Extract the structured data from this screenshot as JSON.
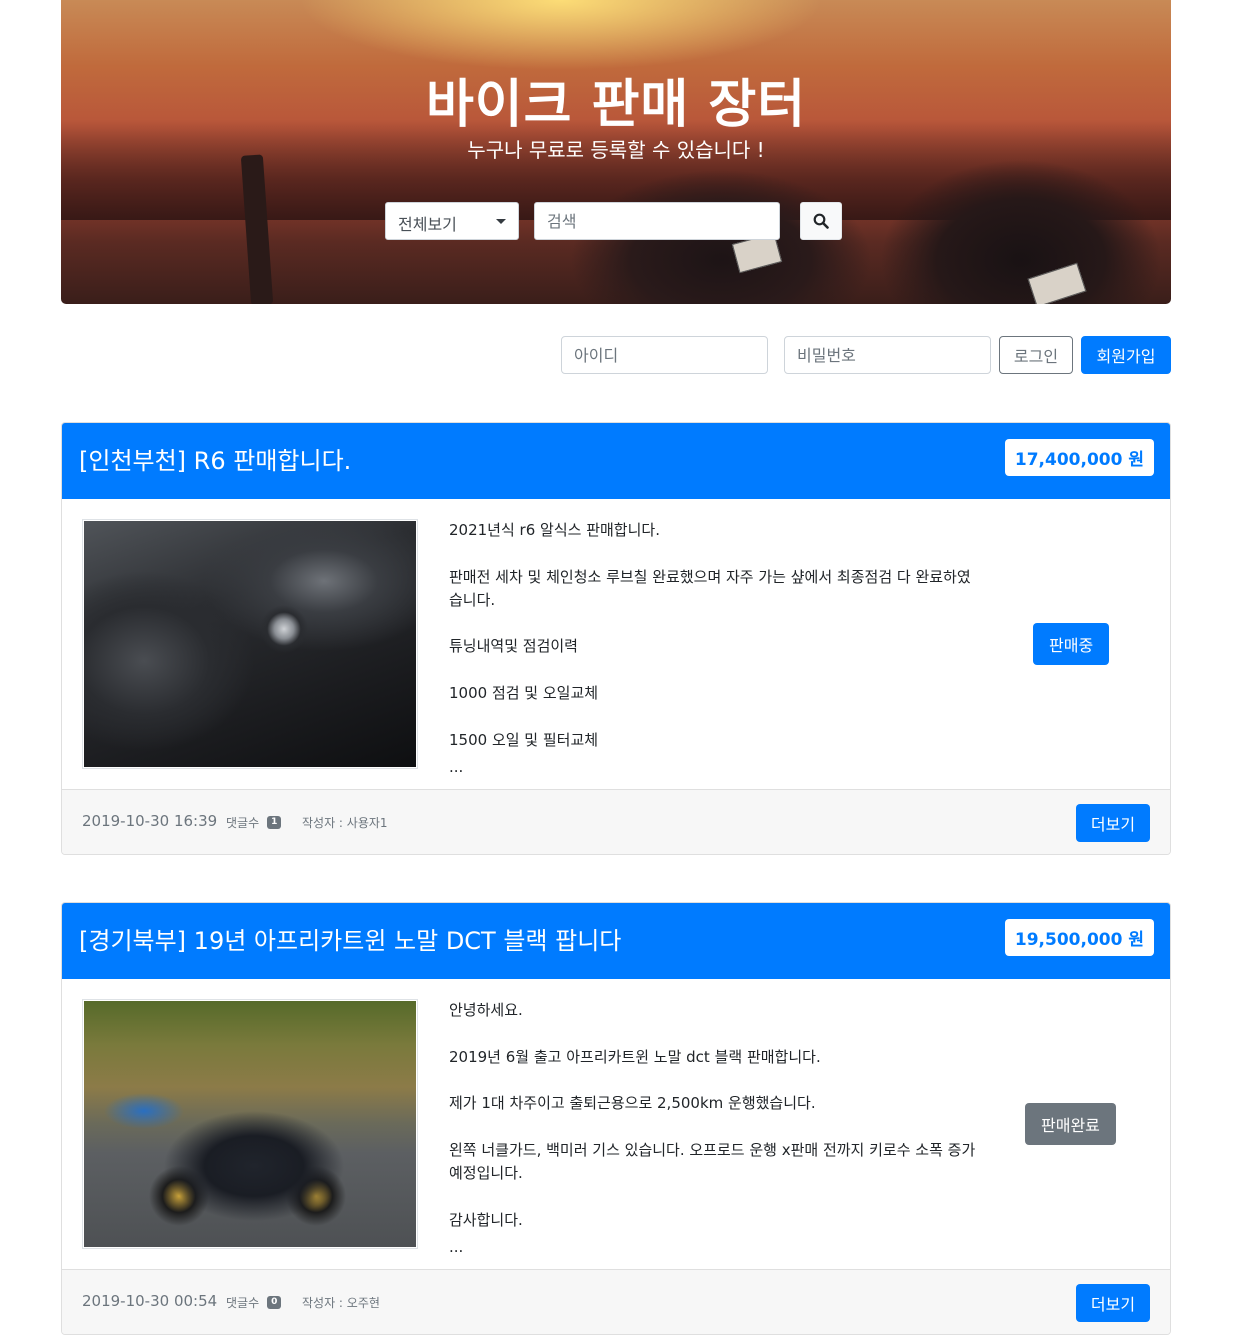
{
  "hero": {
    "title": "바이크 판매 장터",
    "subtitle": "누구나 무료로 등록할 수 있습니다 !",
    "category_selected": "전체보기",
    "search_placeholder": "검색"
  },
  "login": {
    "id_placeholder": "아이디",
    "password_placeholder": "비밀번호",
    "login_label": "로그인",
    "join_label": "회원가입"
  },
  "posts": [
    {
      "title": "[인천부천] R6 판매합니다.",
      "price": "17,400,000 원",
      "description": [
        "2021년식 r6 알식스 판매합니다.",
        "판매전 세차 및 체인청소 루브칠 완료했으며 자주 가는 샾에서 최종점검 다 완료하였습니다.",
        "튜닝내역및 점검이력",
        "1000 점검 및 오일교체",
        "1500 오일 및 필터교체"
      ],
      "ellipsis": "...",
      "status": "판매중",
      "status_color": "#007bff",
      "date": "2019-10-30 16:39",
      "comments_label": "댓글수",
      "comments_count": "1",
      "author": "작성자 : 사용자1",
      "more_label": "더보기"
    },
    {
      "title": "[경기북부] 19년 아프리카트윈 노말 DCT 블랙 팝니다",
      "price": "19,500,000 원",
      "description": [
        "안녕하세요.",
        "2019년 6월 출고 아프리카트윈 노말 dct 블랙 판매합니다.",
        "제가 1대 차주이고 출퇴근용으로 2,500km 운행했습니다.",
        "왼쪽 너클가드, 백미러 기스 있습니다. 오프로드 운행 x판매 전까지 키로수 소폭 증가 예정입니다.",
        "감사합니다."
      ],
      "ellipsis": "...",
      "status": "판매완료",
      "status_color": "#6c757d",
      "date": "2019-10-30 00:54",
      "comments_label": "댓글수",
      "comments_count": "0",
      "author": "작성자 : 오주현",
      "more_label": "더보기"
    }
  ],
  "icons": {
    "search": "search-icon",
    "dropdown": "caret-down-icon"
  },
  "colors": {
    "primary": "#007bff",
    "secondary": "#6c757d"
  }
}
